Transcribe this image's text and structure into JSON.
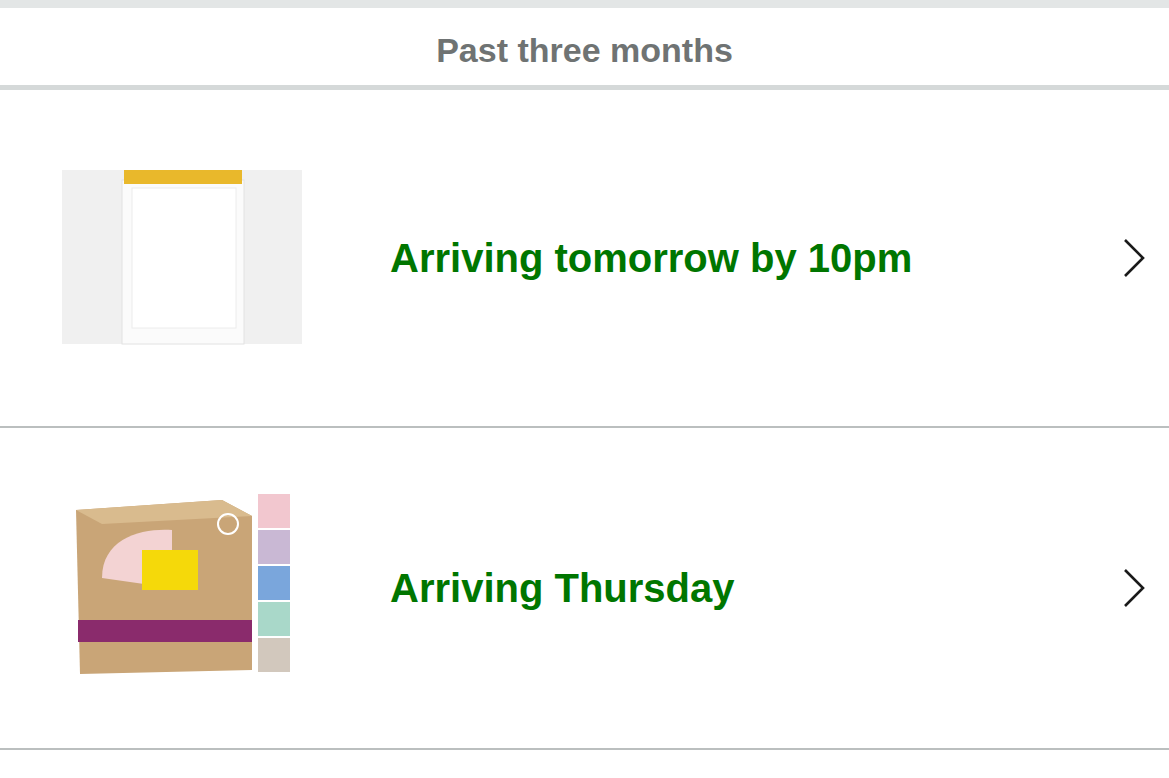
{
  "section": {
    "title": "Past three months"
  },
  "orders": [
    {
      "status": "Arriving tomorrow by 10pm"
    },
    {
      "status": "Arriving Thursday"
    }
  ]
}
